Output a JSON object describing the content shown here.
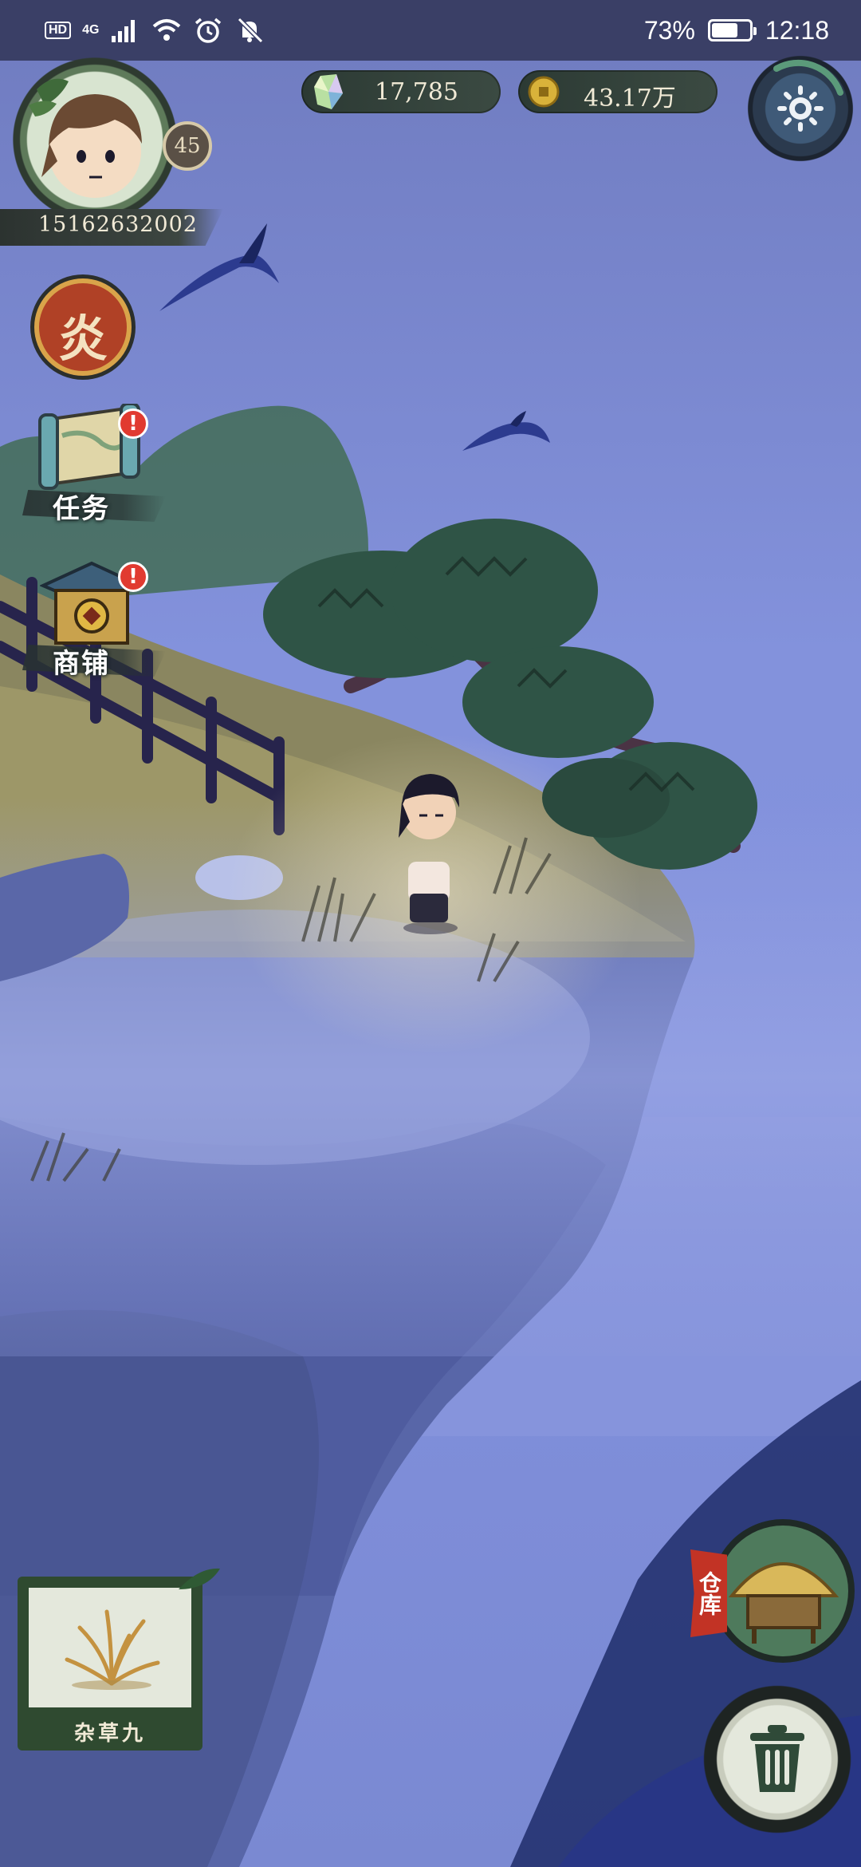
{
  "status_bar": {
    "network_hd": "HD",
    "network_type": "4G",
    "battery_text": "73%",
    "battery_level": 0.73,
    "time": "12:18"
  },
  "player": {
    "level": "45",
    "id": "15162632002"
  },
  "currencies": {
    "gems": "17,785",
    "coins": "43.17万"
  },
  "side_menu": {
    "element_badge": "炎",
    "tasks_label": "任务",
    "shop_label": "商铺",
    "tasks_alert": "!",
    "shop_alert": "!"
  },
  "selected_item": {
    "name": "杂草九"
  },
  "bottom_right": {
    "warehouse_label": "仓库"
  },
  "colors": {
    "sky": "#8090dc",
    "status_bar": "#3a3f66",
    "alert_red": "#e13a30",
    "ink_green": "#2f4a30"
  }
}
